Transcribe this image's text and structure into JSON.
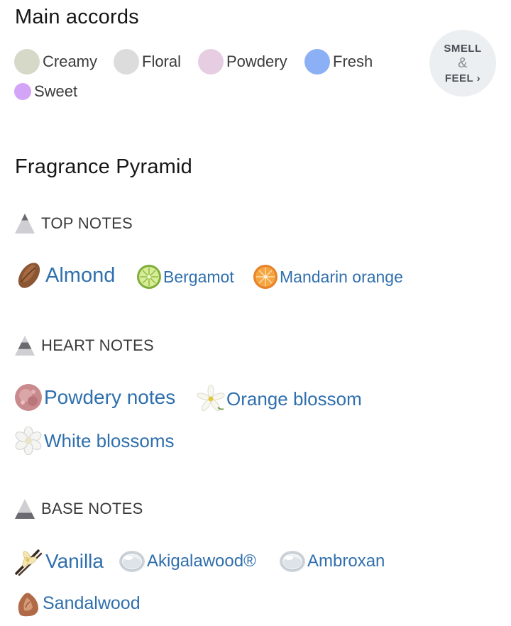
{
  "main_accords": {
    "title": "Main accords",
    "items": [
      {
        "label": "Creamy",
        "color": "#d7d9c8"
      },
      {
        "label": "Floral",
        "color": "#dcdcdc"
      },
      {
        "label": "Powdery",
        "color": "#e7cde2"
      },
      {
        "label": "Fresh",
        "color": "#8bb0f5"
      },
      {
        "label": "Sweet",
        "color": "#d4a5f6"
      }
    ],
    "smell_feel": {
      "line1": "SMELL",
      "amp": "&",
      "line2": "FEEL ›"
    }
  },
  "pyramid": {
    "title": "Fragrance Pyramid",
    "top": {
      "heading": "TOP NOTES",
      "notes": [
        {
          "label": "Almond",
          "icon": "almond-icon"
        },
        {
          "label": "Bergamot",
          "icon": "bergamot-icon"
        },
        {
          "label": "Mandarin orange",
          "icon": "mandarin-orange-icon"
        }
      ]
    },
    "heart": {
      "heading": "HEART NOTES",
      "notes": [
        {
          "label": "Powdery notes",
          "icon": "powder-icon"
        },
        {
          "label": "Orange blossom",
          "icon": "orange-blossom-icon"
        },
        {
          "label": "White blossoms",
          "icon": "white-blossom-icon"
        }
      ]
    },
    "base": {
      "heading": "BASE NOTES",
      "notes": [
        {
          "label": "Vanilla",
          "icon": "vanilla-icon"
        },
        {
          "label": "Akigalawood®",
          "icon": "droplet-icon"
        },
        {
          "label": "Ambroxan",
          "icon": "droplet-icon"
        },
        {
          "label": "Sandalwood",
          "icon": "sandalwood-icon"
        }
      ]
    }
  }
}
